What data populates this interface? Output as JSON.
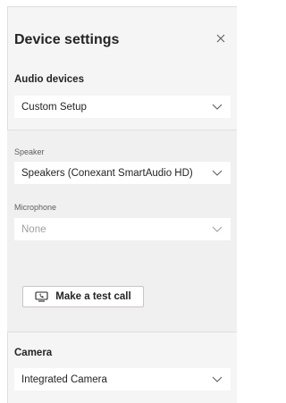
{
  "header": {
    "title": "Device settings"
  },
  "audio": {
    "label": "Audio devices",
    "selected": "Custom Setup"
  },
  "speaker": {
    "label": "Speaker",
    "selected": "Speakers (Conexant SmartAudio HD)"
  },
  "microphone": {
    "label": "Microphone",
    "selected": "None"
  },
  "test_call": {
    "label": "Make a test call"
  },
  "camera": {
    "label": "Camera",
    "selected": "Integrated Camera"
  },
  "icons": {
    "close": "close-icon",
    "chevron": "chevron-down-icon",
    "test_call": "call-device-icon"
  }
}
